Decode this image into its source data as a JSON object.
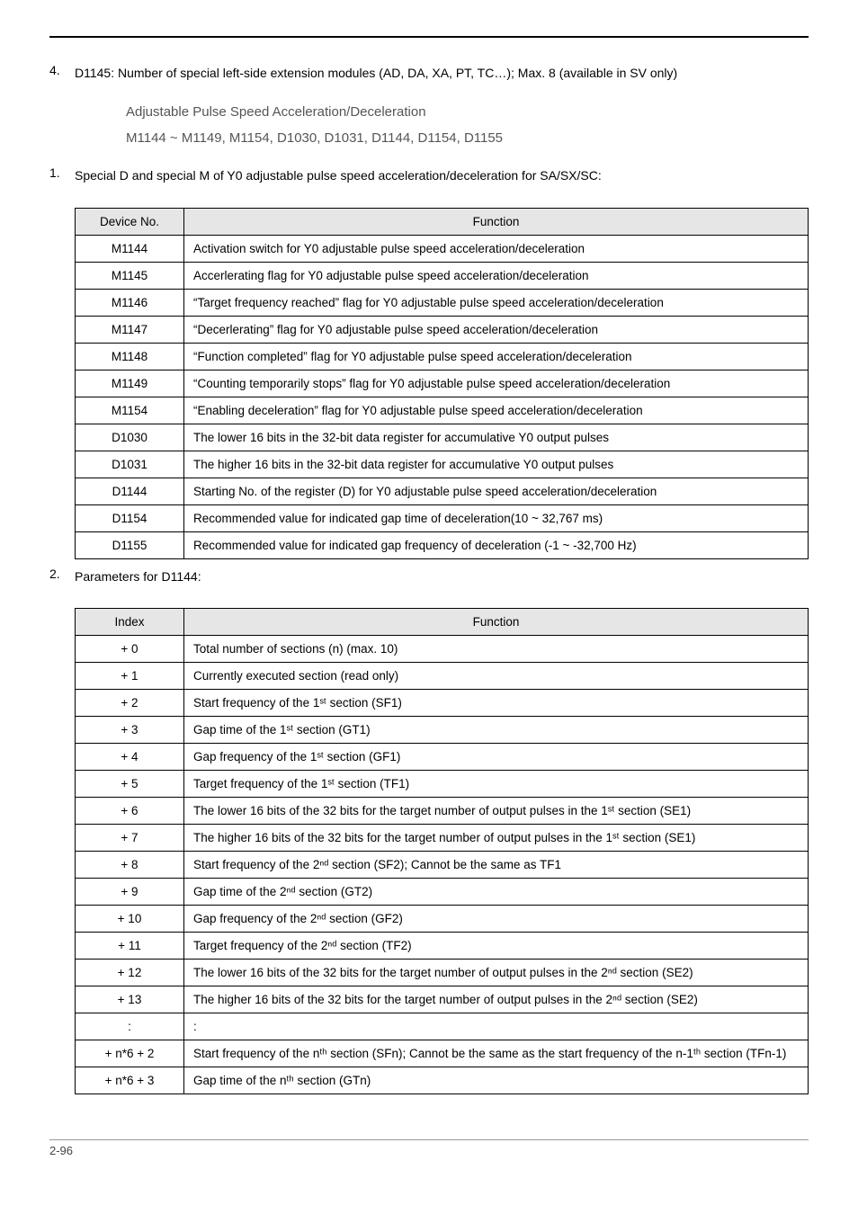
{
  "item4": {
    "num": "4.",
    "text": "D1145: Number of special left-side extension modules (AD, DA, XA, PT, TC…); Max. 8 (available in SV only)"
  },
  "grayHeader": {
    "line1": "Adjustable Pulse Speed Acceleration/Deceleration",
    "line2": "M1144 ~ M1149, M1154, D1030, D1031, D1144, D1154, D1155"
  },
  "section1": {
    "num": "1.",
    "intro": "Special D and special M of Y0 adjustable pulse speed acceleration/deceleration for SA/SX/SC:",
    "headers": {
      "c1": "Device No.",
      "c2": "Function"
    },
    "rows": [
      {
        "c1": "M1144",
        "c2": "Activation switch for Y0 adjustable pulse speed acceleration/deceleration"
      },
      {
        "c1": "M1145",
        "c2": "Accerlerating flag for Y0 adjustable pulse speed acceleration/deceleration"
      },
      {
        "c1": "M1146",
        "c2": "“Target frequency reached” flag for Y0 adjustable pulse speed acceleration/deceleration"
      },
      {
        "c1": "M1147",
        "c2": "“Decerlerating” flag for Y0 adjustable pulse speed acceleration/deceleration"
      },
      {
        "c1": "M1148",
        "c2": "“Function completed” flag for Y0 adjustable pulse speed acceleration/deceleration"
      },
      {
        "c1": "M1149",
        "c2": "“Counting temporarily stops” flag for Y0 adjustable pulse speed acceleration/deceleration"
      },
      {
        "c1": "M1154",
        "c2": "“Enabling deceleration” flag for Y0 adjustable pulse speed acceleration/deceleration"
      },
      {
        "c1": "D1030",
        "c2": "The lower 16 bits in the 32-bit data register for accumulative Y0 output pulses"
      },
      {
        "c1": "D1031",
        "c2": "The higher 16 bits in the 32-bit data register for accumulative Y0 output pulses"
      },
      {
        "c1": "D1144",
        "c2": "Starting No. of the register (D) for Y0 adjustable pulse speed acceleration/deceleration"
      },
      {
        "c1": "D1154",
        "c2": "Recommended value for indicated gap time of deceleration(10 ~ 32,767 ms)"
      },
      {
        "c1": "D1155",
        "c2": "Recommended value for indicated gap frequency of deceleration (-1 ~ -32,700 Hz)"
      }
    ]
  },
  "section2": {
    "num": "2.",
    "intro": "Parameters for D1144:",
    "headers": {
      "c1": "Index",
      "c2": "Function"
    },
    "rows": [
      {
        "c1": "+ 0",
        "c2": "Total number of sections (n) (max. 10)"
      },
      {
        "c1": "+ 1",
        "c2": "Currently executed section (read only)"
      },
      {
        "c1": "+ 2",
        "c2": "Start frequency of the 1ˢᵗ section (SF1)"
      },
      {
        "c1": "+ 3",
        "c2": "Gap time of the 1ˢᵗ section (GT1)"
      },
      {
        "c1": "+ 4",
        "c2": "Gap frequency of the 1ˢᵗ section (GF1)"
      },
      {
        "c1": "+ 5",
        "c2": "Target frequency of the 1ˢᵗ section (TF1)"
      },
      {
        "c1": "+ 6",
        "c2": "The lower 16 bits of the 32 bits for the target number of output pulses in the 1ˢᵗ section (SE1)"
      },
      {
        "c1": "+ 7",
        "c2": "The higher 16 bits of the 32 bits for the target number of output pulses in the 1ˢᵗ section (SE1)"
      },
      {
        "c1": "+ 8",
        "c2": "Start frequency of the 2ⁿᵈ section (SF2); Cannot be the same as TF1"
      },
      {
        "c1": "+ 9",
        "c2": "Gap time of the 2ⁿᵈ section (GT2)"
      },
      {
        "c1": "+ 10",
        "c2": "Gap frequency of the 2ⁿᵈ section (GF2)"
      },
      {
        "c1": "+ 11",
        "c2": "Target frequency of the 2ⁿᵈ section (TF2)"
      },
      {
        "c1": "+ 12",
        "c2": "The lower 16 bits of the 32 bits for the target number of output pulses in the 2ⁿᵈ section (SE2)"
      },
      {
        "c1": "+ 13",
        "c2": "The higher 16 bits of the 32 bits for the target number of output pulses in the 2ⁿᵈ section (SE2)"
      },
      {
        "c1": ":",
        "c2": "  :"
      },
      {
        "c1": "+ n*6 + 2",
        "c2": "Start frequency of the nᵗʰ section (SFn); Cannot be the same as the start frequency of the n-1ᵗʰ section (TFn-1)"
      },
      {
        "c1": "+ n*6 + 3",
        "c2": "Gap time of the nᵗʰ section (GTn)"
      }
    ]
  },
  "footer": {
    "page": "2-96"
  }
}
